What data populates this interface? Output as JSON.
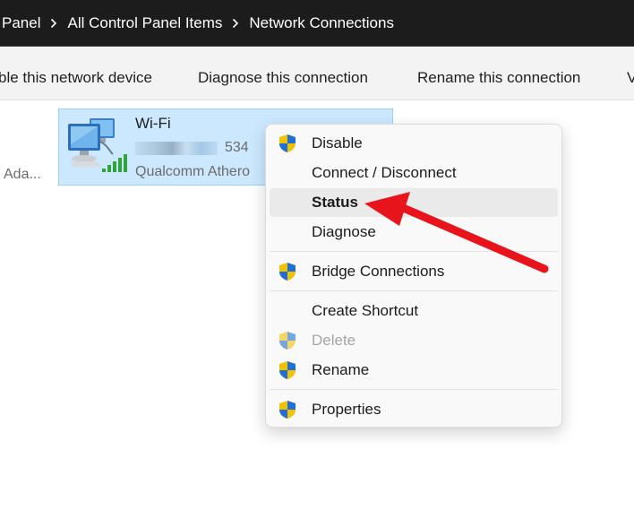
{
  "breadcrumb": {
    "items": [
      "Panel",
      "All Control Panel Items",
      "Network Connections"
    ]
  },
  "toolbar": {
    "items": [
      "ble this network device",
      "Diagnose this connection",
      "Rename this connection",
      "V"
    ]
  },
  "content": {
    "left_truncated_label": "Ada...",
    "wifi_item": {
      "name": "Wi-Fi",
      "network_suffix": "534",
      "adapter": "Qualcomm Athero"
    }
  },
  "context_menu": {
    "items": [
      {
        "label": "Disable",
        "shield": true,
        "state": "normal"
      },
      {
        "label": "Connect / Disconnect",
        "shield": false,
        "state": "normal"
      },
      {
        "label": "Status",
        "shield": false,
        "state": "hover"
      },
      {
        "label": "Diagnose",
        "shield": false,
        "state": "normal"
      },
      {
        "label": "Bridge Connections",
        "shield": true,
        "state": "normal"
      },
      {
        "label": "Create Shortcut",
        "shield": false,
        "state": "normal"
      },
      {
        "label": "Delete",
        "shield": true,
        "state": "disabled"
      },
      {
        "label": "Rename",
        "shield": true,
        "state": "normal"
      },
      {
        "label": "Properties",
        "shield": true,
        "state": "normal"
      }
    ]
  },
  "icons": {
    "breadcrumb_separator": "chevron-right-icon",
    "wifi_item": "network-computers-icon",
    "signal": "signal-bars-icon",
    "uac": "uac-shield-icon"
  },
  "colors": {
    "address_bar_bg": "#1c1c1c",
    "selection_bg": "#cce8ff",
    "selection_border": "#99d1ff",
    "menu_hover": "#eaeaea",
    "annotation_arrow": "#e8141b"
  }
}
